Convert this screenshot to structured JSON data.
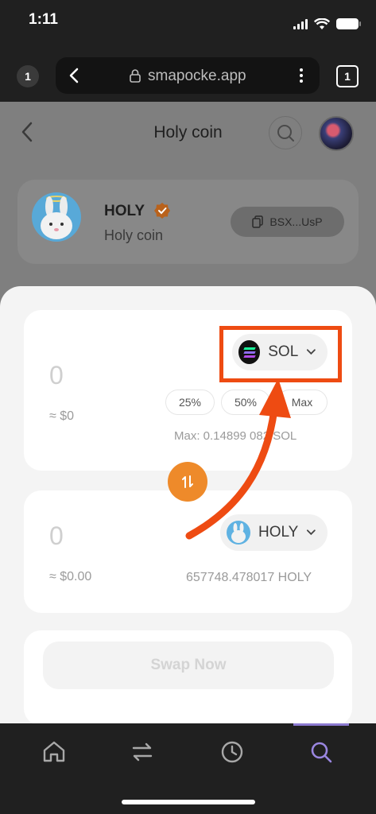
{
  "status_bar": {
    "time": "1:11"
  },
  "browser": {
    "tab_count_left": "1",
    "url": "smapocke.app",
    "tabs_count": "1"
  },
  "page": {
    "title": "Holy coin",
    "token": {
      "symbol": "HOLY",
      "name": "Holy coin",
      "address": "BSX...UsP"
    }
  },
  "swap": {
    "from": {
      "amount": "0",
      "usd": "≈ $0",
      "token": "SOL",
      "percent_buttons": [
        "25%",
        "50%",
        "Max"
      ],
      "max_label": "Max: 0.14899 082 SOL"
    },
    "to": {
      "amount": "0",
      "usd": "≈ $0.00",
      "token": "HOLY",
      "balance": "657748.478017 HOLY"
    },
    "swap_button": "Swap Now"
  },
  "colors": {
    "accent_orange": "#ee8a2a",
    "highlight_red": "#ee4b12",
    "nav_active": "#8c7ad0"
  },
  "icons": {
    "nav": [
      "home-icon",
      "swap-icon",
      "history-icon",
      "search-icon"
    ]
  }
}
